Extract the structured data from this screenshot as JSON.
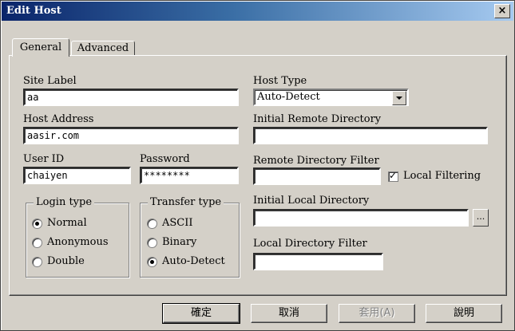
{
  "window": {
    "title": "Edit Host",
    "close_glyph": "×"
  },
  "tabs": [
    {
      "label": "General",
      "selected": true
    },
    {
      "label": "Advanced",
      "selected": false
    }
  ],
  "general": {
    "site_label": {
      "label": "Site Label",
      "value": "aa"
    },
    "host_address": {
      "label": "Host Address",
      "value": "aasir.com"
    },
    "user_id": {
      "label": "User ID",
      "value": "chaiyen"
    },
    "password": {
      "label": "Password",
      "value": "********"
    },
    "host_type": {
      "label": "Host Type",
      "value": "Auto-Detect"
    },
    "initial_remote_dir": {
      "label": "Initial Remote Directory",
      "value": ""
    },
    "remote_dir_filter": {
      "label": "Remote Directory Filter",
      "value": ""
    },
    "local_filtering": {
      "label": "Local Filtering",
      "checked": true
    },
    "initial_local_dir": {
      "label": "Initial Local Directory",
      "value": "",
      "browse_label": "..."
    },
    "local_dir_filter": {
      "label": "Local Directory Filter",
      "value": ""
    },
    "login_type": {
      "label": "Login type",
      "options": [
        {
          "label": "Normal",
          "selected": true
        },
        {
          "label": "Anonymous",
          "selected": false
        },
        {
          "label": "Double",
          "selected": false
        }
      ]
    },
    "transfer_type": {
      "label": "Transfer type",
      "options": [
        {
          "label": "ASCII",
          "selected": false
        },
        {
          "label": "Binary",
          "selected": false
        },
        {
          "label": "Auto-Detect",
          "selected": true
        }
      ]
    }
  },
  "buttons": {
    "ok": "確定",
    "cancel": "取消",
    "apply": "套用(A)",
    "help": "說明"
  }
}
